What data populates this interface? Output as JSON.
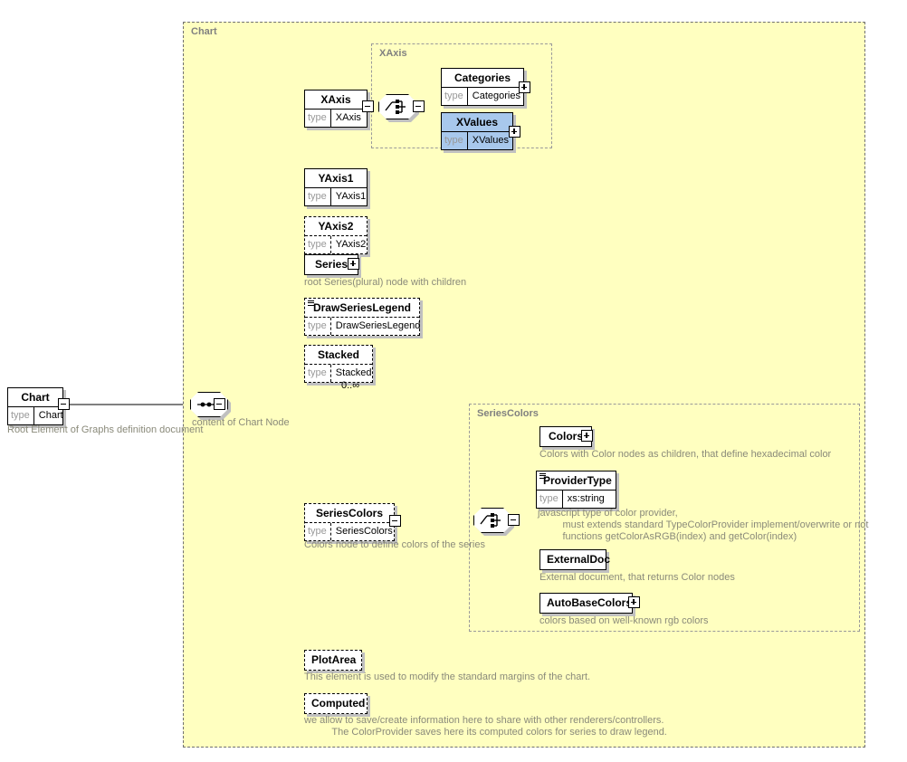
{
  "diagram": {
    "title": "Chart",
    "groups": [
      {
        "id": "chart",
        "label": "Chart"
      },
      {
        "id": "xaxis",
        "label": "XAxis"
      },
      {
        "id": "seriescolors",
        "label": "SeriesColors"
      }
    ]
  },
  "root": {
    "name": "Chart",
    "type_key": "type",
    "type_value": "Chart",
    "annotation": "Root Element of Graphs definition document",
    "expander": "minus"
  },
  "sequence_chart": {
    "icon": "sequence-compositor-icon",
    "annotation": "content of Chart Node",
    "expander": "minus"
  },
  "nodes": {
    "xaxis": {
      "name": "XAxis",
      "type_key": "type",
      "type_value": "XAxis",
      "optional": false,
      "expander": "minus"
    },
    "categories": {
      "name": "Categories",
      "type_key": "type",
      "type_value": "Categories",
      "optional": false,
      "expander": "plus"
    },
    "xvalues": {
      "name": "XValues",
      "type_key": "type",
      "type_value": "XValues",
      "optional": false,
      "selected": true,
      "expander": "plus"
    },
    "yaxis1": {
      "name": "YAxis1",
      "type_key": "type",
      "type_value": "YAxis1",
      "optional": false
    },
    "yaxis2": {
      "name": "YAxis2",
      "type_key": "type",
      "type_value": "YAxis2",
      "optional": true
    },
    "series": {
      "name": "Series",
      "optional": false,
      "expander": "plus",
      "annotation": "root Series(plural) node with children"
    },
    "drawserieslegend": {
      "name": "DrawSeriesLegend",
      "type_key": "type",
      "type_value": "DrawSeriesLegend",
      "optional": true,
      "default_marker": true
    },
    "stacked": {
      "name": "Stacked",
      "type_key": "type",
      "type_value": "Stacked",
      "optional": true,
      "occurs": "0..∞"
    },
    "seriescolors": {
      "name": "SeriesColors",
      "type_key": "type",
      "type_value": "SeriesColors",
      "optional": true,
      "expander": "minus",
      "annotation": "Colors node to define colors of the series"
    },
    "colors": {
      "name": "Colors",
      "optional": false,
      "expander": "plus",
      "annotation": "Colors with Color nodes as children, that define hexadecimal color"
    },
    "providertype": {
      "name": "ProviderType",
      "type_key": "type",
      "type_value": "xs:string",
      "optional": false,
      "default_marker": true,
      "annotation": "javascript type of color provider,\n         must extends standard TypeColorProvider implement/overwrite or not\n         functions getColorAsRGB(index) and getColor(index)"
    },
    "externaldoc": {
      "name": "ExternalDoc",
      "optional": false,
      "annotation": "External document, that returns Color nodes"
    },
    "autobasecolors": {
      "name": "AutoBaseColors",
      "optional": false,
      "expander": "plus",
      "annotation": "colors based on well-known rgb colors"
    },
    "plotarea": {
      "name": "PlotArea",
      "optional": true,
      "annotation": "This element is used to modify the standard margins of the chart."
    },
    "computed": {
      "name": "Computed",
      "optional": true,
      "annotation": "we allow to save/create information here to share with other renderers/controllers.\n          The ColorProvider saves here its computed colors for series to draw legend."
    }
  },
  "compositors": {
    "xaxis_choice": {
      "icon": "choice-compositor-icon",
      "expander": "minus"
    },
    "seriescolors_choice": {
      "icon": "choice-compositor-icon",
      "expander": "minus"
    }
  },
  "colors": {
    "group_background": "#ffffc0",
    "group_border": "#808080",
    "node_border": "#000000",
    "node_background": "#ffffff",
    "selected_background": "#a8c8ec",
    "annotation_text": "#8a8a7a",
    "type_key_text": "#999999",
    "shadow": "#c0c0c0"
  }
}
